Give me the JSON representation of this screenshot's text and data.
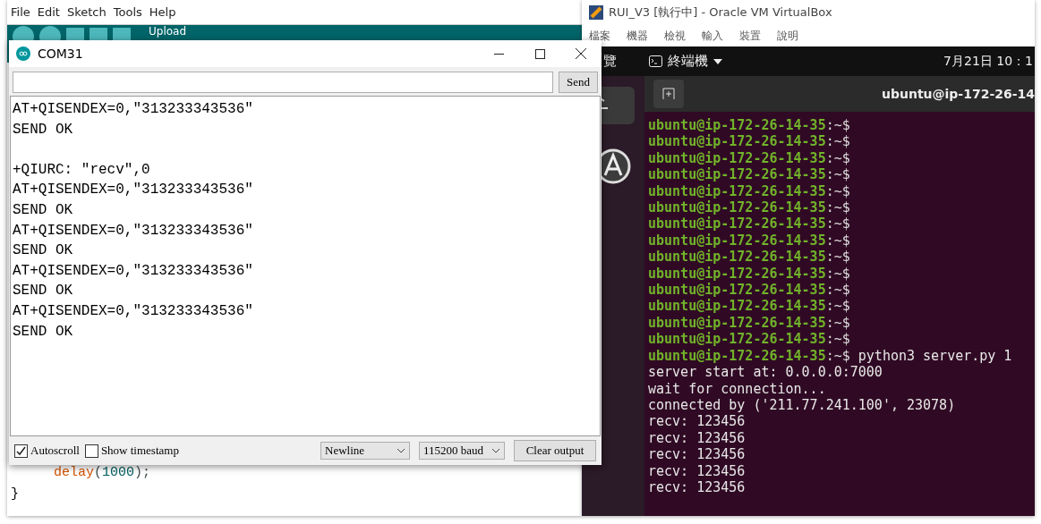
{
  "ide": {
    "menu": [
      "File",
      "Edit",
      "Sketch",
      "Tools",
      "Help"
    ],
    "toolbar_label": "Upload",
    "code": [
      {
        "kind": "call",
        "name": "delay",
        "open": "(",
        "arg": "1000",
        "close": ");"
      },
      {
        "kind": "plain",
        "text": "}"
      }
    ]
  },
  "vm": {
    "title": "RUI_V3 [執行中] - Oracle VM VirtualBox",
    "menu": [
      "檔案",
      "機器",
      "檢視",
      "輸入",
      "裝置",
      "說明"
    ],
    "topbar": {
      "activities": "覽",
      "app": "終端機",
      "clock": "7月21日 10：1"
    },
    "terminal": {
      "title": "ubuntu@ip-172-26-14",
      "lines": [
        {
          "kind": "prompt",
          "host": "ubuntu@ip-172-26-14-35",
          "rest": ":~$"
        },
        {
          "kind": "prompt",
          "host": "ubuntu@ip-172-26-14-35",
          "rest": ":~$"
        },
        {
          "kind": "prompt",
          "host": "ubuntu@ip-172-26-14-35",
          "rest": ":~$"
        },
        {
          "kind": "prompt",
          "host": "ubuntu@ip-172-26-14-35",
          "rest": ":~$"
        },
        {
          "kind": "prompt",
          "host": "ubuntu@ip-172-26-14-35",
          "rest": ":~$"
        },
        {
          "kind": "prompt",
          "host": "ubuntu@ip-172-26-14-35",
          "rest": ":~$"
        },
        {
          "kind": "prompt",
          "host": "ubuntu@ip-172-26-14-35",
          "rest": ":~$"
        },
        {
          "kind": "prompt",
          "host": "ubuntu@ip-172-26-14-35",
          "rest": ":~$"
        },
        {
          "kind": "prompt",
          "host": "ubuntu@ip-172-26-14-35",
          "rest": ":~$"
        },
        {
          "kind": "prompt",
          "host": "ubuntu@ip-172-26-14-35",
          "rest": ":~$"
        },
        {
          "kind": "prompt",
          "host": "ubuntu@ip-172-26-14-35",
          "rest": ":~$"
        },
        {
          "kind": "prompt",
          "host": "ubuntu@ip-172-26-14-35",
          "rest": ":~$"
        },
        {
          "kind": "prompt",
          "host": "ubuntu@ip-172-26-14-35",
          "rest": ":~$"
        },
        {
          "kind": "prompt",
          "host": "ubuntu@ip-172-26-14-35",
          "rest": ":~$"
        },
        {
          "kind": "prompt",
          "host": "ubuntu@ip-172-26-14-35",
          "rest": ":~$",
          "command": "python3 server.py 1"
        },
        {
          "kind": "output",
          "text": "server start at: 0.0.0.0:7000"
        },
        {
          "kind": "output",
          "text": "wait for connection..."
        },
        {
          "kind": "output",
          "text": "connected by ('211.77.241.100', 23078)"
        },
        {
          "kind": "output",
          "text": "recv: 123456"
        },
        {
          "kind": "output",
          "text": "recv: 123456"
        },
        {
          "kind": "output",
          "text": "recv: 123456"
        },
        {
          "kind": "output",
          "text": "recv: 123456"
        },
        {
          "kind": "output",
          "text": "recv: 123456"
        }
      ]
    }
  },
  "serial": {
    "title": "COM31",
    "send": "Send",
    "lines": [
      {
        "kind": "text",
        "text": "AT+QISENDEX=0,\"313233343536\""
      },
      {
        "kind": "text",
        "text": "SEND OK"
      },
      {
        "kind": "blank"
      },
      {
        "kind": "text",
        "text": "+QIURC: \"recv\",0"
      },
      {
        "kind": "text",
        "text": "AT+QISENDEX=0,\"313233343536\""
      },
      {
        "kind": "text",
        "text": "SEND OK"
      },
      {
        "kind": "text",
        "text": "AT+QISENDEX=0,\"313233343536\""
      },
      {
        "kind": "text",
        "text": "SEND OK"
      },
      {
        "kind": "text",
        "text": "AT+QISENDEX=0,\"313233343536\""
      },
      {
        "kind": "text",
        "text": "SEND OK"
      },
      {
        "kind": "text",
        "text": "AT+QISENDEX=0,\"313233343536\""
      },
      {
        "kind": "text",
        "text": "SEND OK"
      }
    ],
    "autoscroll": {
      "label": "Autoscroll",
      "checked": true
    },
    "timestamp": {
      "label": "Show timestamp",
      "checked": false
    },
    "line_ending": "Newline",
    "baud": "115200 baud",
    "clear": "Clear output"
  }
}
